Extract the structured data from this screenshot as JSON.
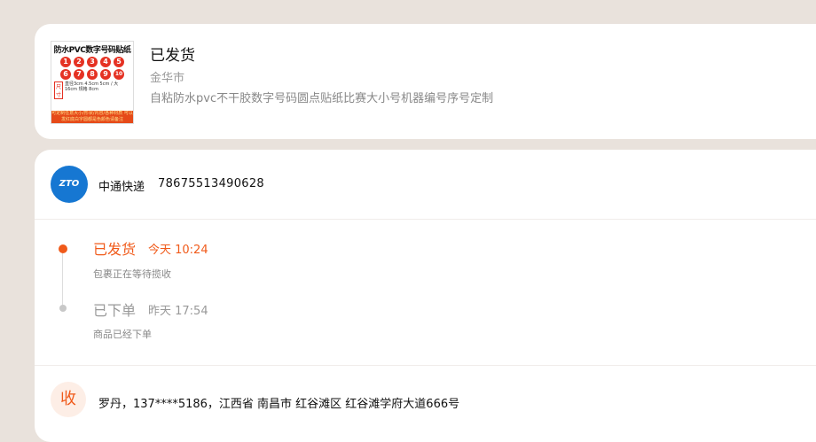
{
  "order": {
    "thumbnail": {
      "title": "防水PVC数字号码贴纸",
      "numbers_row1": [
        "1",
        "2",
        "3",
        "4",
        "5"
      ],
      "numbers_row2": [
        "6",
        "7",
        "8",
        "9",
        "10"
      ],
      "ruler": "尺寸",
      "sizes": "直径3cm 4.5cm 5cm / 大16cm 规格 8cm",
      "band": "可定制任意大小/形状/内容/各种材质 可以发红底白字圆都是色颜色请备注"
    },
    "status": "已发货",
    "city": "金华市",
    "title": "自粘防水pvc不干胶数字号码圆点贴纸比赛大小号机器编号序号定制"
  },
  "logistics": {
    "carrier_logo_text": "ZTO",
    "carrier_name": "中通快递",
    "tracking_number": "78675513490628",
    "events": [
      {
        "status": "已发货",
        "time": "今天 10:24",
        "desc": "包裹正在等待揽收",
        "active": true
      },
      {
        "status": "已下单",
        "time": "昨天 17:54",
        "desc": "商品已经下单",
        "active": false
      }
    ],
    "receiver_icon": "收",
    "receiver_text": "罗丹，137****5186，江西省 南昌市 红谷滩区 红谷滩学府大道666号"
  },
  "colors": {
    "accent": "#f05a1a",
    "background": "#e9e2dc",
    "carrier_blue": "#1677d2"
  }
}
